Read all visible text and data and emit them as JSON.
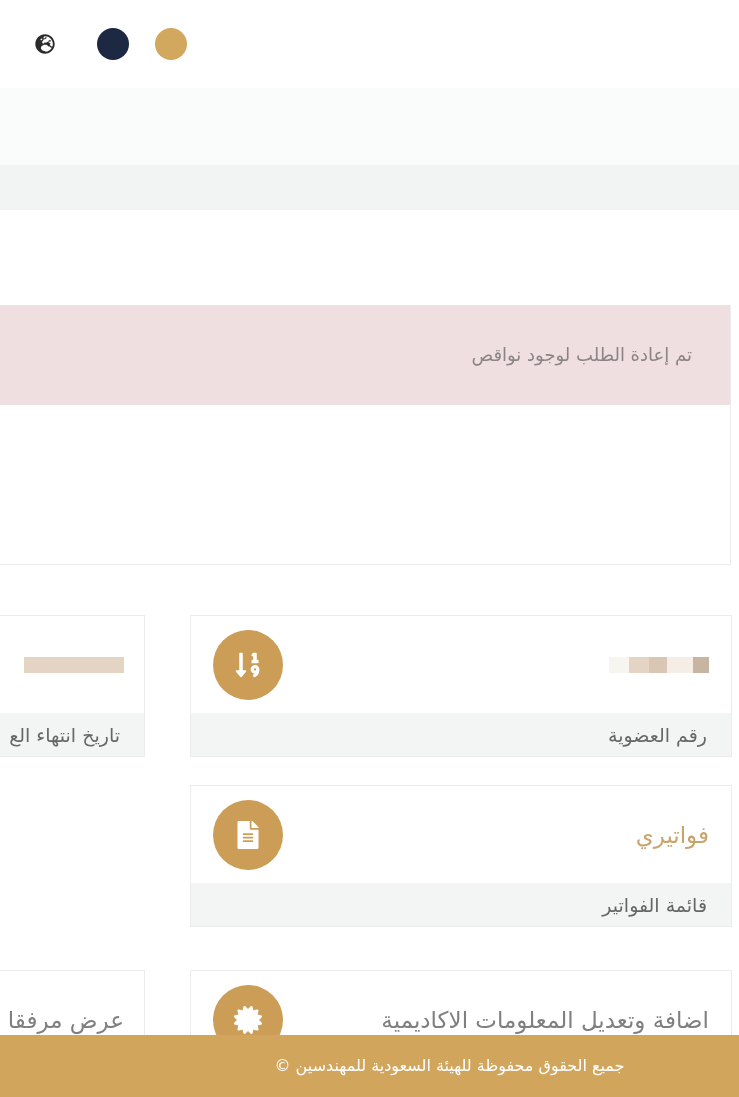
{
  "header": {
    "theme_swatches": [
      {
        "color": "#d2a75e"
      },
      {
        "color": "#1d2942"
      }
    ]
  },
  "notice": {
    "text": "تم إعادة الطلب لوجود نواقص"
  },
  "card_rows": [
    {
      "cards": [
        {
          "kind": "value",
          "label": "رقم العضوية"
        },
        {
          "kind": "value",
          "label": "تاريخ انتهاء الع"
        }
      ]
    },
    {
      "cards": [
        {
          "kind": "link",
          "title": "فواتيري",
          "accent": true,
          "label": "قائمة الفواتير"
        }
      ]
    },
    {
      "cards": [
        {
          "kind": "link",
          "title": "اضافة وتعديل المعلومات الاكاديمية",
          "accent": false
        },
        {
          "kind": "link",
          "title": "عرض مرفقا",
          "accent": false
        }
      ]
    }
  ],
  "footer": {
    "text": "جميع الحقوق محفوظة للهيئة السعودية للمهندسين ©"
  }
}
